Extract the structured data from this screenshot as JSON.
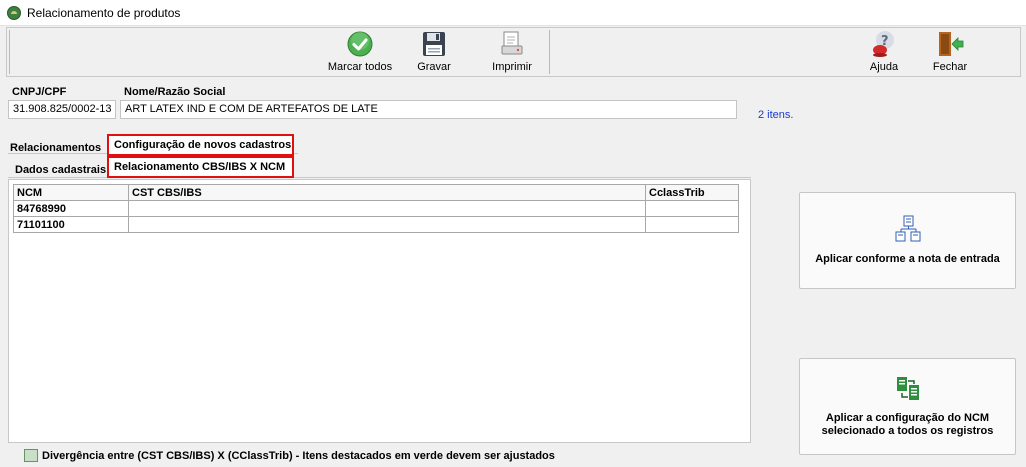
{
  "window": {
    "title": "Relacionamento de produtos"
  },
  "toolbar": {
    "mark_all": "Marcar todos",
    "save": "Gravar",
    "print": "Imprimir",
    "help": "Ajuda",
    "close": "Fechar"
  },
  "header": {
    "cnpj_label": "CNPJ/CPF",
    "cnpj_value": "31.908.825/0002-13",
    "name_label": "Nome/Razão Social",
    "name_value": "ART LATEX IND E COM DE ARTEFATOS DE LATE",
    "item_count": "2 itens."
  },
  "tabs": {
    "relacionamentos": "Relacionamentos",
    "config_novos": "Configuração de novos cadastros",
    "dados_cadastrais": "Dados cadastrais",
    "rel_cbs_ncm": "Relacionamento CBS/IBS X NCM"
  },
  "grid": {
    "columns": [
      "NCM",
      "CST CBS/IBS",
      "CclassTrib"
    ],
    "rows": [
      {
        "ncm": "84768990",
        "cst": "",
        "cclass": ""
      },
      {
        "ncm": "71101100",
        "cst": "",
        "cclass": ""
      }
    ]
  },
  "actions": {
    "apply_entry": "Aplicar conforme a nota de entrada",
    "apply_ncm_line1": "Aplicar a configuração do NCM",
    "apply_ncm_line2": "selecionado a todos  os registros"
  },
  "legend": {
    "text": "Divergência entre (CST CBS/IBS) X (CClassTrib) - Itens destacados em verde devem ser ajustados",
    "swatch_color": "#c8e0c6"
  },
  "colors": {
    "highlight_border": "#e01010",
    "link": "#1a3acc"
  }
}
